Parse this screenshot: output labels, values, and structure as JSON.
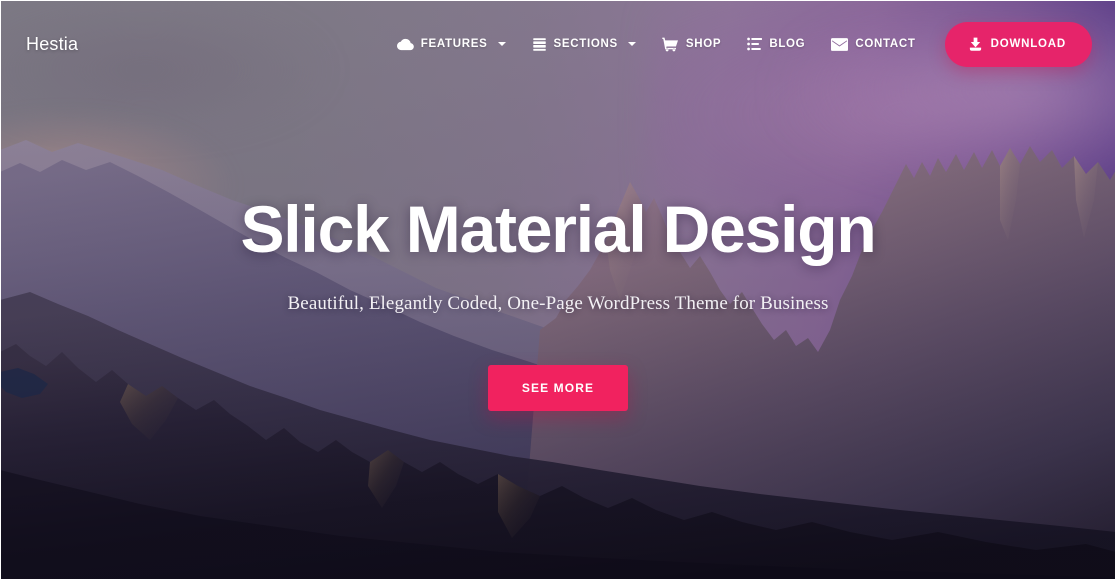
{
  "site": {
    "brand": "Hestia"
  },
  "nav": {
    "items": [
      {
        "label": "FEATURES",
        "icon": "cloud-icon",
        "has_caret": true
      },
      {
        "label": "SECTIONS",
        "icon": "sections-icon",
        "has_caret": true
      },
      {
        "label": "SHOP",
        "icon": "cart-icon",
        "has_caret": false
      },
      {
        "label": "BLOG",
        "icon": "list-icon",
        "has_caret": false
      },
      {
        "label": "CONTACT",
        "icon": "envelope-icon",
        "has_caret": false
      }
    ],
    "download_button": {
      "label": "DOWNLOAD",
      "icon": "download-icon",
      "color": "#e6246a"
    }
  },
  "hero": {
    "title": "Slick Material Design",
    "subtitle": "Beautiful, Elegantly Coded, One-Page WordPress Theme for Business",
    "cta_label": "SEE MORE",
    "cta_color": "#f1225f"
  },
  "theme": {
    "accent": "#e6246a",
    "text_on_hero": "#ffffff",
    "sky_left": "#84828a",
    "sky_right": "#4a3084"
  }
}
